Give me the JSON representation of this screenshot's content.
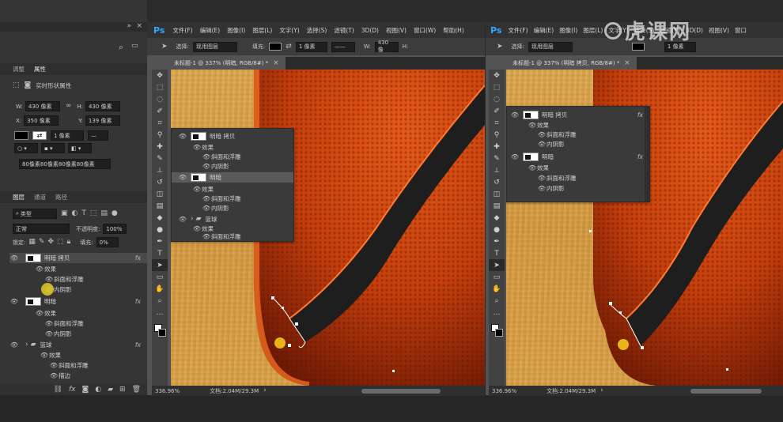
{
  "left_panel": {
    "tabs": [
      "调整",
      "属性"
    ],
    "props_title": "实时形状属性",
    "w_label": "W:",
    "w_value": "430 像素",
    "h_label": "H:",
    "h_value": "430 像素",
    "x_label": "X:",
    "x_value": "350 像素",
    "y_label": "Y:",
    "y_value": "139 像素",
    "stroke_value": "1 像素",
    "corners_value": "80像素80像素80像素80像素",
    "layer_tabs": [
      "图层",
      "通道",
      "路径"
    ],
    "filter_kind": "类型",
    "blend_mode": "正常",
    "opacity_label": "不透明度:",
    "opacity_value": "100%",
    "lock_label": "锁定:",
    "fill_label": "填充:",
    "fill_value": "0%",
    "layers": [
      {
        "name": "明暗 拷贝",
        "type": "layer",
        "fx": "fx"
      },
      {
        "name": "效果",
        "type": "effects"
      },
      {
        "name": "斜面和浮雕",
        "type": "effect"
      },
      {
        "name": "内阴影",
        "type": "effect"
      },
      {
        "name": "明暗",
        "type": "layer",
        "fx": "fx"
      },
      {
        "name": "效果",
        "type": "effects"
      },
      {
        "name": "斜面和浮雕",
        "type": "effect"
      },
      {
        "name": "内阴影",
        "type": "effect"
      },
      {
        "name": "篮球",
        "type": "group",
        "fx": "fx"
      },
      {
        "name": "效果",
        "type": "effects"
      },
      {
        "name": "斜面和浮雕",
        "type": "effect"
      },
      {
        "name": "描边",
        "type": "effect"
      }
    ]
  },
  "app": {
    "logo": "Ps",
    "menu": [
      "文件(F)",
      "编辑(E)",
      "图像(I)",
      "图层(L)",
      "文字(Y)",
      "选择(S)",
      "滤镜(T)",
      "3D(D)",
      "视图(V)",
      "窗口(W)",
      "帮助(H)"
    ],
    "menu_right": [
      "文件(F)",
      "编辑(E)",
      "图像(I)",
      "图层(L)",
      "文字(Y)",
      "选择(S)",
      "滤镜(T)",
      "3D(D)",
      "视图(V)",
      "窗口"
    ],
    "options": {
      "select_label": "选择:",
      "select_value": "现用图层",
      "fill_label": "填充:",
      "stroke_value": "1 像素",
      "w_label": "W:",
      "w_value": "430 像",
      "h_label": "H:"
    },
    "doc_tab": "未标题-1 @ 337% (明暗, RGB/8#) *",
    "doc_tab_right": "未标题-1 @ 337% (明暗 拷贝, RGB/8#) *",
    "zoom": "336.96%",
    "doc_info": "文档:2.04M/29.3M",
    "watermark": "虎课网"
  },
  "popup_left": {
    "rows": [
      {
        "name": "明暗 拷贝",
        "type": "layer"
      },
      {
        "name": "效果",
        "type": "effects"
      },
      {
        "name": "斜面和浮雕",
        "type": "effect"
      },
      {
        "name": "内阴影",
        "type": "effect"
      },
      {
        "name": "明暗",
        "type": "layer"
      },
      {
        "name": "效果",
        "type": "effects"
      },
      {
        "name": "斜面和浮雕",
        "type": "effect"
      },
      {
        "name": "内阴影",
        "type": "effect"
      },
      {
        "name": "篮球",
        "type": "group"
      },
      {
        "name": "效果",
        "type": "effects"
      },
      {
        "name": "斜面和浮雕",
        "type": "effect"
      }
    ]
  },
  "popup_right": {
    "rows": [
      {
        "name": "明暗 拷贝",
        "type": "layer",
        "fx": "fx"
      },
      {
        "name": "效果",
        "type": "effects"
      },
      {
        "name": "斜面和浮雕",
        "type": "effect"
      },
      {
        "name": "内阴影",
        "type": "effect"
      },
      {
        "name": "明暗",
        "type": "layer",
        "fx": "fx"
      },
      {
        "name": "效果",
        "type": "effects"
      },
      {
        "name": "斜面和浮雕",
        "type": "effect"
      },
      {
        "name": "内阴影",
        "type": "effect"
      }
    ]
  },
  "colors": {
    "accent": "#f5c518",
    "ball": "#d4460e",
    "seam": "#1e1e1e",
    "wood": "#d9a24a"
  }
}
